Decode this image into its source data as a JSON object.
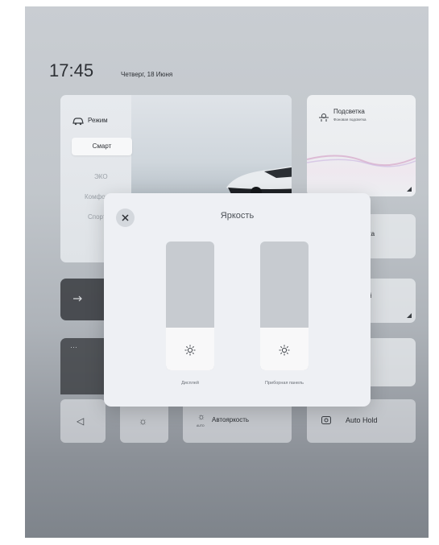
{
  "status": {
    "time": "17:45",
    "date": "Четверг, 18 Июня"
  },
  "mode": {
    "label": "Режим",
    "selected": "Смарт",
    "options": [
      "ЭКО",
      "Комфорт",
      "Спорт"
    ]
  },
  "backlight": {
    "title": "Подсветка",
    "subtitle": "Фоновая подсветка"
  },
  "tiles": {
    "partial_a": "ка",
    "partial_b": "й"
  },
  "buttons": {
    "auto_brightness": "Автояркость",
    "auto_brightness_sub": "AUTO",
    "auto_hold": "Auto Hold"
  },
  "modal": {
    "title": "Яркость",
    "sliders": [
      {
        "label": "Дисплей",
        "level": 0.33
      },
      {
        "label": "Приборная панель",
        "level": 0.33
      }
    ]
  },
  "colors": {
    "accent_dark": "#373a3e",
    "modal_bg": "#eef0f4",
    "slider_track": "#c7cbd0"
  }
}
